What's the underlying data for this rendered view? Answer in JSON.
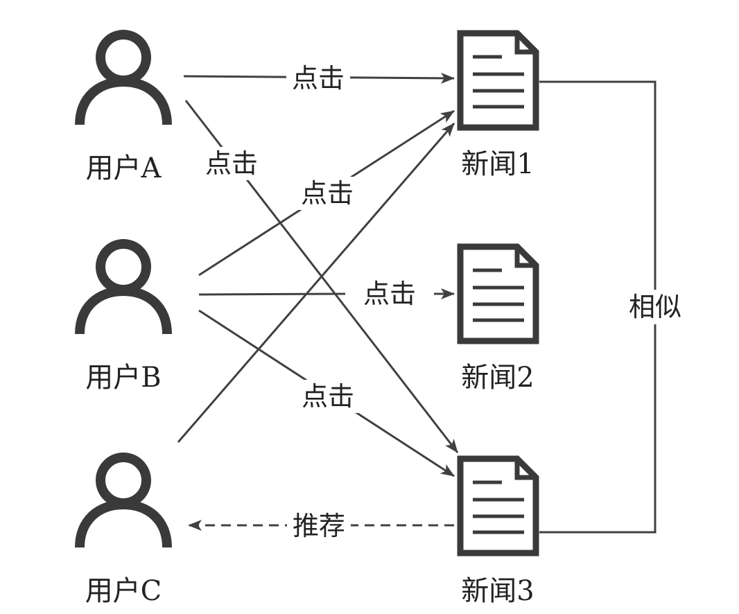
{
  "users": [
    {
      "id": "a",
      "label": "用户A"
    },
    {
      "id": "b",
      "label": "用户B"
    },
    {
      "id": "c",
      "label": "用户C"
    }
  ],
  "news": [
    {
      "id": "1",
      "label": "新闻1"
    },
    {
      "id": "2",
      "label": "新闻2"
    },
    {
      "id": "3",
      "label": "新闻3"
    }
  ],
  "edges": {
    "a_to_news1": "点击",
    "a_to_news3": "点击",
    "b_to_news1": "点击",
    "b_to_news2": "点击",
    "b_to_news3": "点击",
    "c_to_news1": "",
    "news3_to_c": "推荐",
    "news1_news3_similar": "相似"
  },
  "colors": {
    "line": "#404040",
    "icon": "#3a3a3a",
    "text": "#222222"
  },
  "icons": {
    "user": "user-icon",
    "news": "document-icon"
  }
}
